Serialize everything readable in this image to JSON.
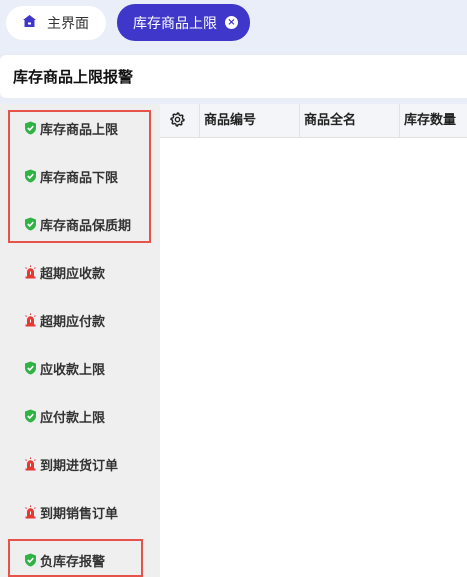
{
  "tabs": {
    "home_label": "主界面",
    "active_label": "库存商品上限",
    "close_glyph": "×"
  },
  "page": {
    "title": "库存商品上限报警"
  },
  "sidebar": {
    "items": [
      {
        "label": "库存商品上限",
        "icon": "shield-check-icon"
      },
      {
        "label": "库存商品下限",
        "icon": "shield-check-icon"
      },
      {
        "label": "库存商品保质期",
        "icon": "shield-check-icon"
      },
      {
        "label": "超期应收款",
        "icon": "alarm-icon"
      },
      {
        "label": "超期应付款",
        "icon": "alarm-icon"
      },
      {
        "label": "应收款上限",
        "icon": "shield-check-icon"
      },
      {
        "label": "应付款上限",
        "icon": "shield-check-icon"
      },
      {
        "label": "到期进货订单",
        "icon": "alarm-icon"
      },
      {
        "label": "到期销售订单",
        "icon": "alarm-icon"
      },
      {
        "label": "负库存报警",
        "icon": "shield-check-icon"
      }
    ]
  },
  "table": {
    "columns": [
      "商品编号",
      "商品全名",
      "库存数量"
    ]
  },
  "colors": {
    "accent": "#3f37c9",
    "shield_green": "#2fb344",
    "alarm_red": "#e53935",
    "highlight_border": "#e5534b"
  }
}
